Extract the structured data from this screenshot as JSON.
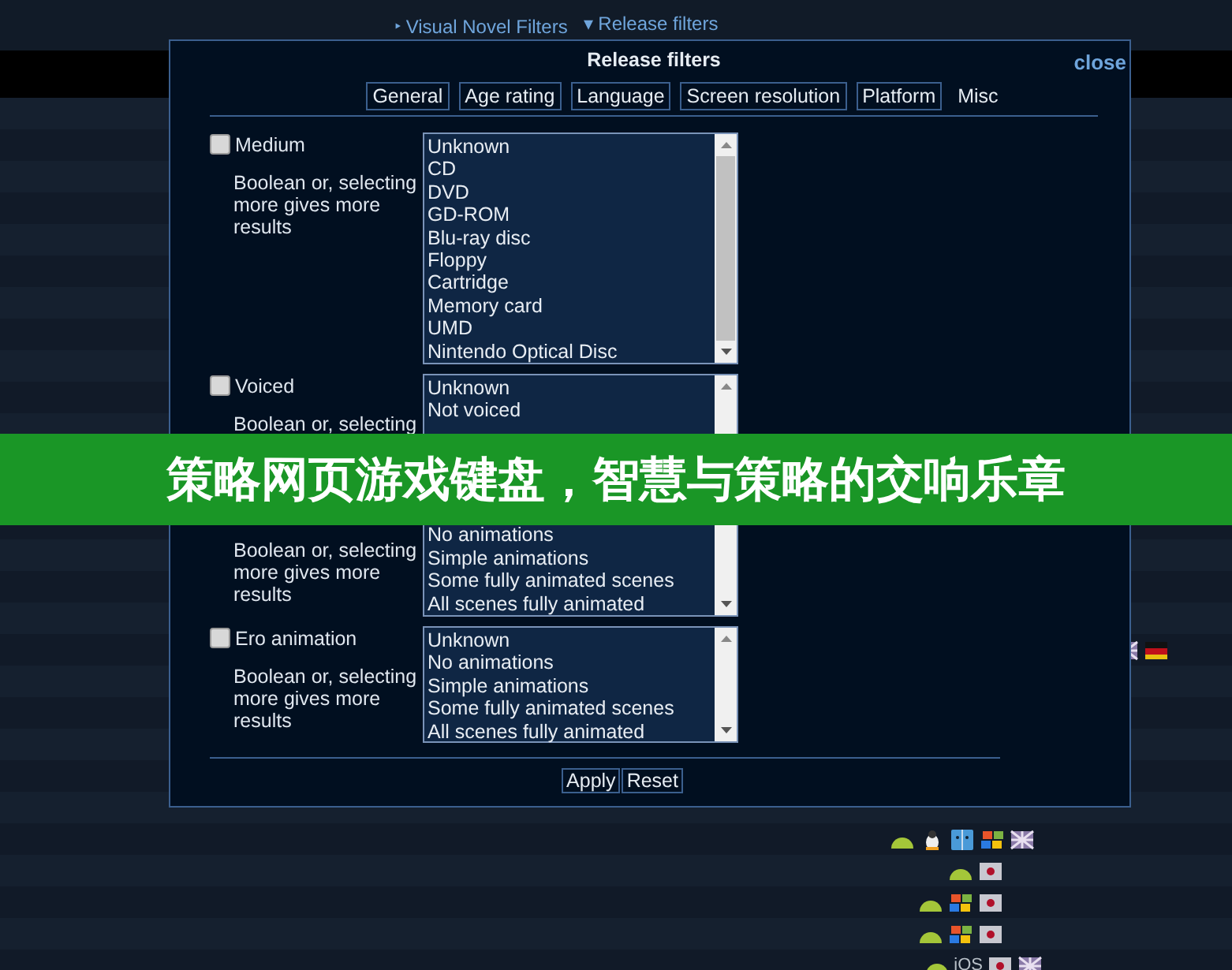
{
  "nav": {
    "links": [
      {
        "arrow": "‣",
        "label": "Visual Novel Filters"
      },
      {
        "arrow": "▾",
        "label": "Release filters"
      }
    ]
  },
  "dialog": {
    "title": "Release filters",
    "close": "close",
    "tabs": [
      {
        "label": "General",
        "selected": false
      },
      {
        "label": "Age rating",
        "selected": false
      },
      {
        "label": "Language",
        "selected": false
      },
      {
        "label": "Screen resolution",
        "selected": false
      },
      {
        "label": "Platform",
        "selected": false
      },
      {
        "label": "Misc",
        "selected": true
      }
    ],
    "filters": [
      {
        "label": "Medium",
        "checked": false,
        "description": "Boolean or, selecting more gives more results",
        "options": [
          "Unknown",
          "CD",
          "DVD",
          "GD-ROM",
          "Blu-ray disc",
          "Floppy",
          "Cartridge",
          "Memory card",
          "UMD",
          "Nintendo Optical Disc"
        ]
      },
      {
        "label": "Voiced",
        "checked": false,
        "description": "Boolean or, selecting",
        "options": [
          "Unknown",
          "Not voiced"
        ]
      },
      {
        "description": "Boolean or, selecting more gives more results",
        "options": [
          "No animations",
          "Simple animations",
          "Some fully animated scenes",
          "All scenes fully animated"
        ]
      },
      {
        "label": "Ero animation",
        "checked": false,
        "description": "Boolean or, selecting more gives more results",
        "options": [
          "Unknown",
          "No animations",
          "Simple animations",
          "Some fully animated scenes",
          "All scenes fully animated"
        ]
      }
    ],
    "buttons": [
      "Apply",
      "Reset"
    ]
  },
  "listing": {
    "last_row_text": "iOS"
  },
  "banner": {
    "text": "策略网页游戏键盘，智慧与策略的交响乐章"
  }
}
